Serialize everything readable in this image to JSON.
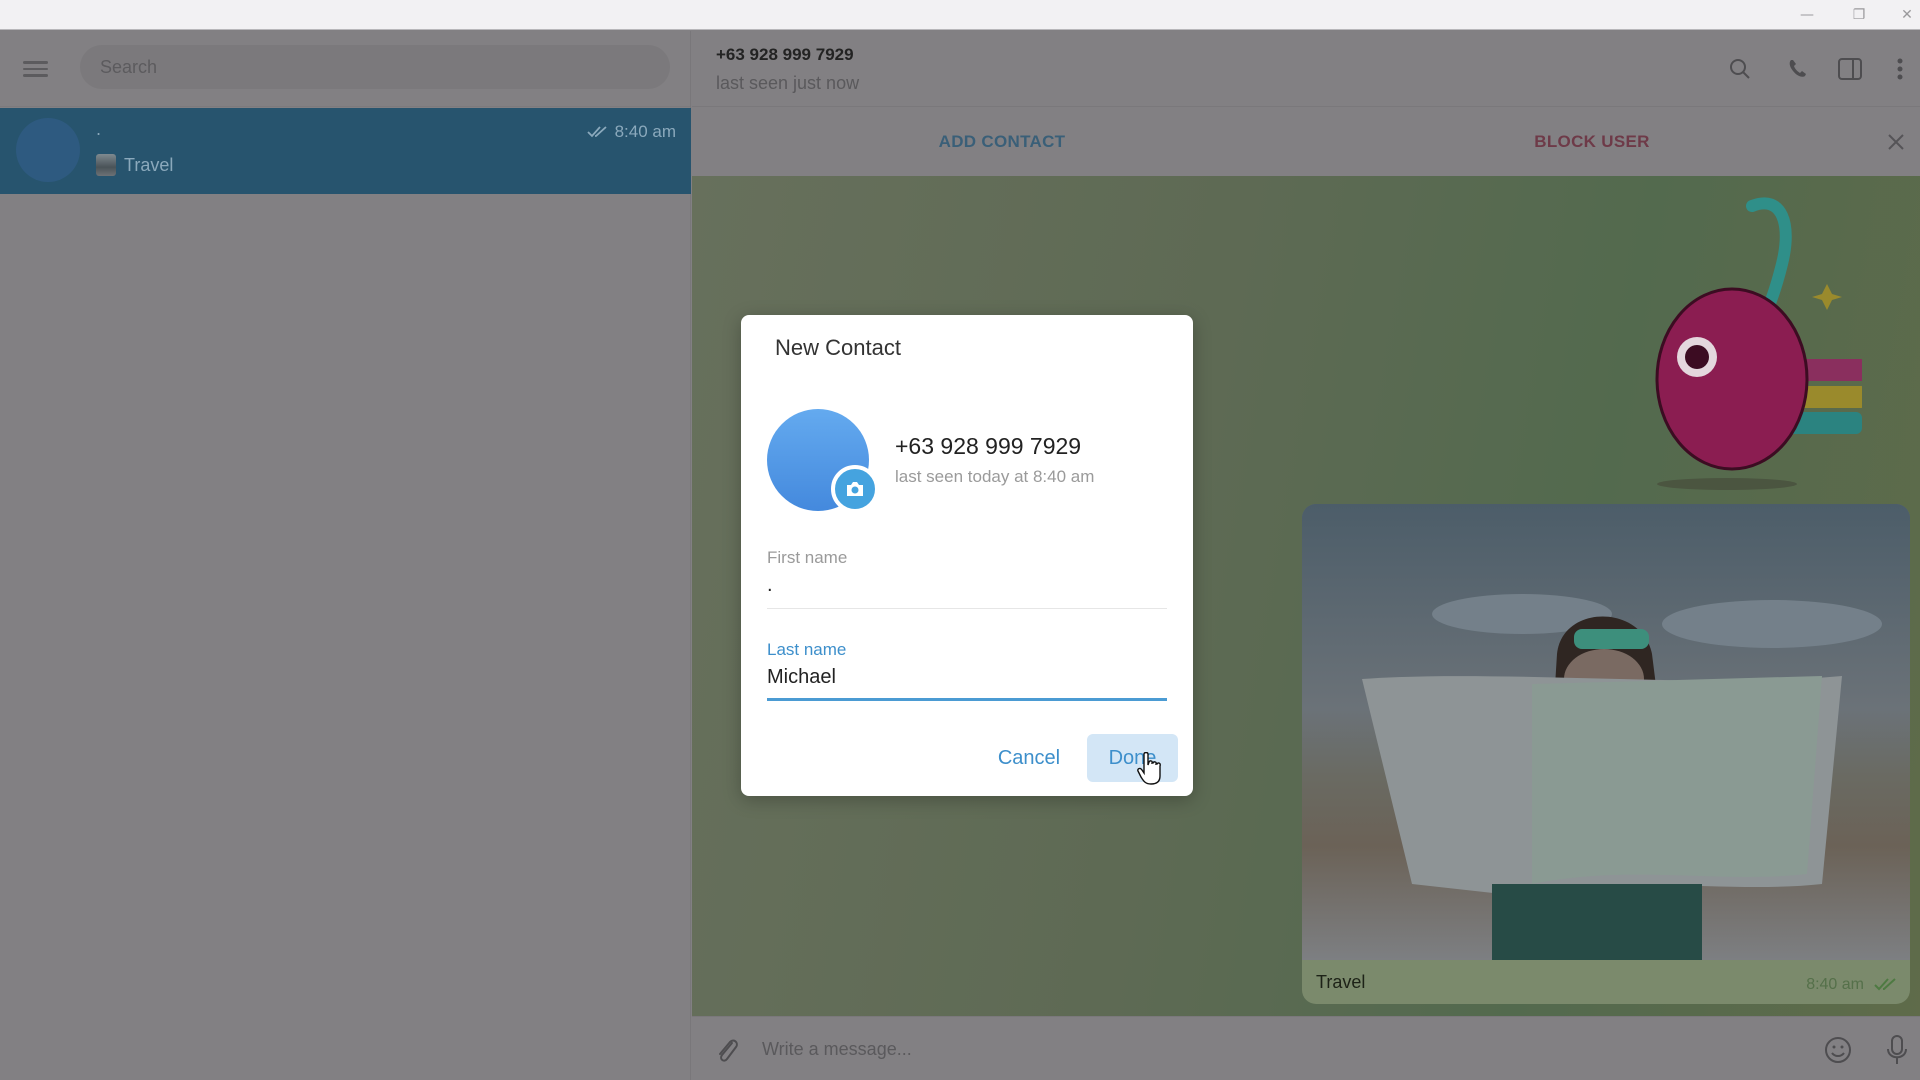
{
  "window": {
    "controls": {
      "minimize": "—",
      "restore": "❐",
      "close": "✕"
    }
  },
  "sidebar": {
    "search_placeholder": "Search",
    "menu_icon": "hamburger-menu-icon",
    "badge_icon": "telegram-logo-icon",
    "chats": [
      {
        "name": ".",
        "time": "8:40 am",
        "status": "read",
        "preview": "Travel",
        "selected": true
      }
    ]
  },
  "chat": {
    "peer_name": "+63 928 999 7929",
    "peer_status": "last seen just now",
    "header_icons": [
      "search-icon",
      "phone-icon",
      "sidebar-toggle-icon",
      "more-vertical-icon"
    ],
    "action_bar": {
      "add_contact": "ADD CONTACT",
      "block_user": "BLOCK USER"
    },
    "messages": [
      {
        "type": "sticker",
        "description": "cherry sticker"
      },
      {
        "type": "photo",
        "caption": "Travel",
        "time": "8:40 am",
        "status": "read"
      }
    ],
    "composer": {
      "placeholder": "Write a message..."
    }
  },
  "dialog": {
    "title": "New Contact",
    "phone": "+63 928 999 7929",
    "last_seen": "last seen today at 8:40 am",
    "first_name": {
      "label": "First name",
      "value": "."
    },
    "last_name": {
      "label": "Last name",
      "value": "Michael"
    },
    "cancel_label": "Cancel",
    "done_label": "Done"
  },
  "colors": {
    "accent": "#3d8fcb",
    "selected_chat": "#27546e",
    "block_red": "#6e3a48"
  }
}
